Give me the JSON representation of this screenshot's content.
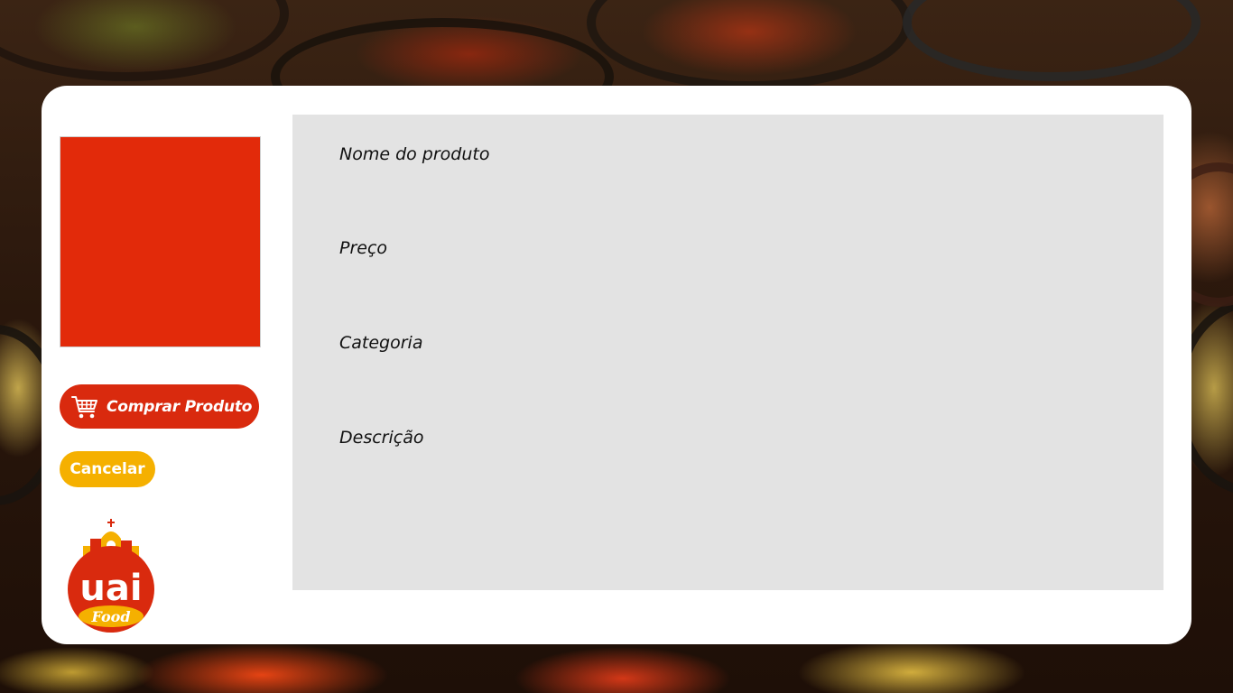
{
  "product": {
    "image_color": "#e22a0a",
    "fields": {
      "name_label": "Nome do produto",
      "price_label": "Preço",
      "category_label": "Categoria",
      "description_label": "Descrição"
    }
  },
  "actions": {
    "buy_label": "Comprar Produto",
    "buy_icon": "shopping-cart-icon",
    "cancel_label": "Cancelar"
  },
  "brand": {
    "logo_text": "uai",
    "logo_subtext": "Food"
  },
  "colors": {
    "primary": "#d92a0e",
    "secondary": "#f5b000",
    "panel": "#e3e3e3",
    "card": "#ffffff"
  }
}
